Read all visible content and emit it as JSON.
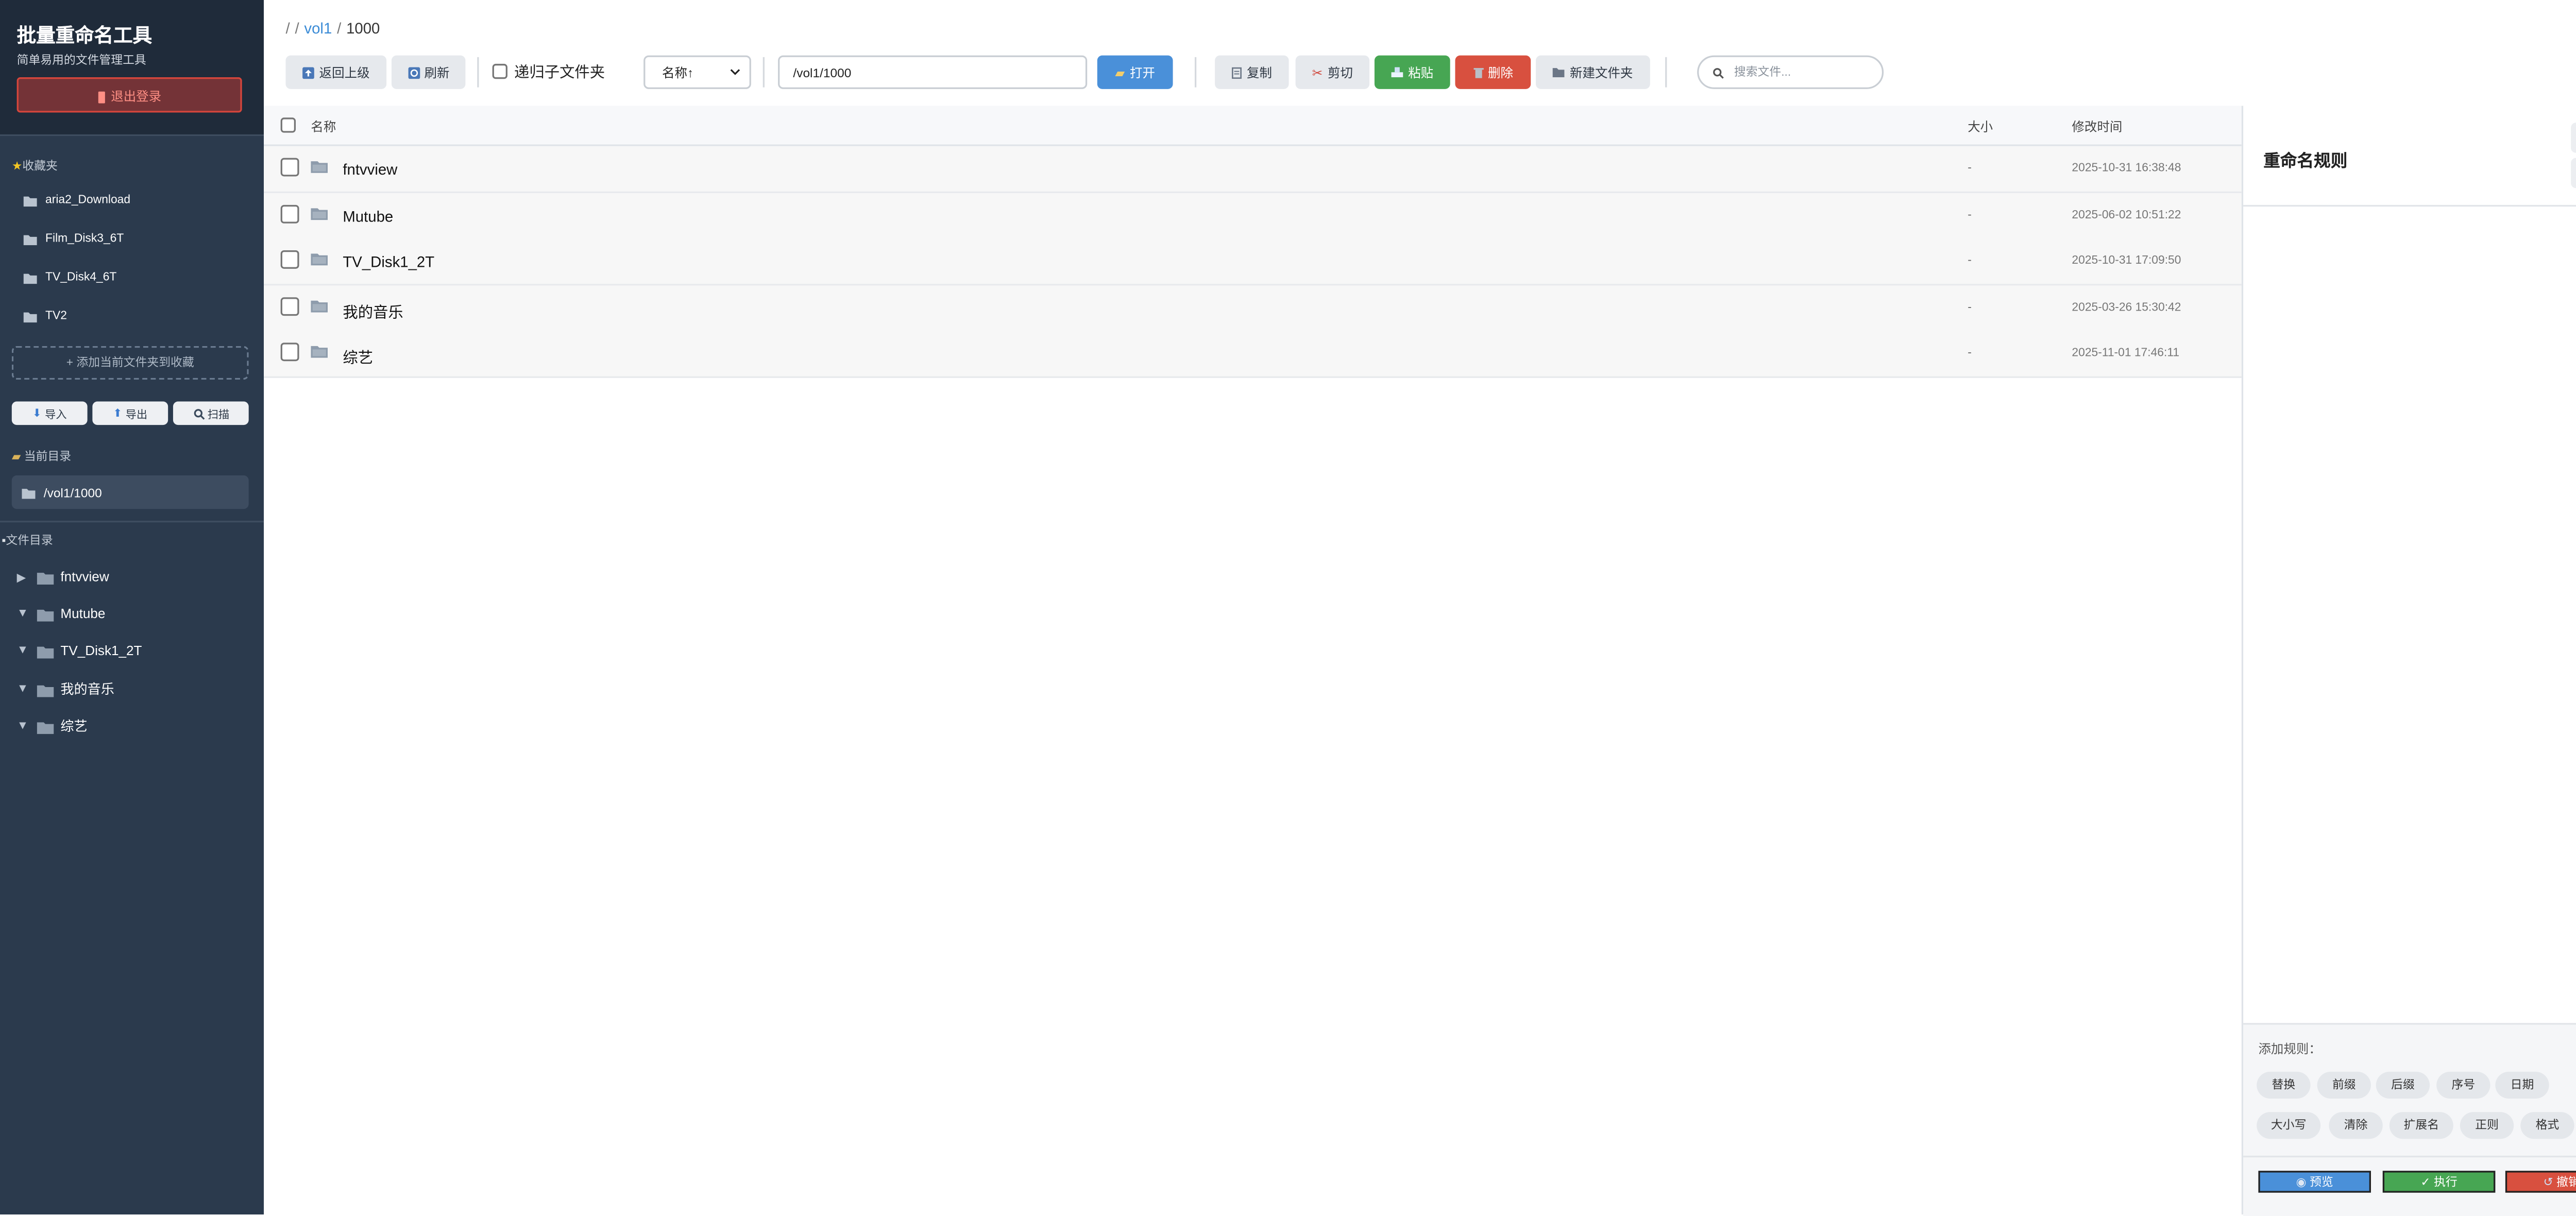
{
  "sidebar": {
    "title": "批量重命名工具",
    "subtitle": "简单易用的文件管理工具",
    "logout": "退出登录",
    "favorites_title": "收藏夹",
    "favorites": [
      "aria2_Download",
      "Film_Disk3_6T",
      "TV_Disk4_6T",
      "TV2"
    ],
    "add_favorite": "+ 添加当前文件夹到收藏",
    "import": "导入",
    "export": "导出",
    "scan": "扫描",
    "current_dir_title": "当前目录",
    "current_dir": "/vol1/1000",
    "tree_title": "文件目录",
    "tree": [
      {
        "name": "fntvview",
        "expanded": false
      },
      {
        "name": "Mutube",
        "expanded": true
      },
      {
        "name": "TV_Disk1_2T",
        "expanded": true
      },
      {
        "name": "我的音乐",
        "expanded": true
      },
      {
        "name": "综艺",
        "expanded": true
      }
    ]
  },
  "toolbar": {
    "breadcrumb": {
      "root": "/",
      "sep": "/",
      "vol": "vol1",
      "current": "1000"
    },
    "back": "返回上级",
    "refresh": "刷新",
    "recursive": "递归子文件夹",
    "sort": "名称↑",
    "path": "/vol1/1000",
    "open": "打开",
    "copy": "复制",
    "cut": "剪切",
    "paste": "粘贴",
    "delete": "删除",
    "new_folder": "新建文件夹",
    "search_placeholder": "搜索文件..."
  },
  "table": {
    "headers": {
      "name": "名称",
      "size": "大小",
      "modified": "修改时间"
    },
    "rows": [
      {
        "name": "fntvview",
        "size": "-",
        "modified": "2025-10-31 16:38:48"
      },
      {
        "name": "Mutube",
        "size": "-",
        "modified": "2025-06-02 10:51:22"
      },
      {
        "name": "TV_Disk1_2T",
        "size": "-",
        "modified": "2025-10-31 17:09:50"
      },
      {
        "name": "我的音乐",
        "size": "-",
        "modified": "2025-03-26 15:30:42"
      },
      {
        "name": "综艺",
        "size": "-",
        "modified": "2025-11-01 17:46:11"
      }
    ]
  },
  "rules": {
    "title": "重命名规则",
    "add_label": "添加规则：",
    "chips_row1": [
      "替换",
      "前缀",
      "后缀",
      "序号",
      "日期"
    ],
    "chips_row2": [
      "大小写",
      "清除",
      "扩展名",
      "正则",
      "格式"
    ],
    "preview": "预览",
    "execute": "执行",
    "undo": "撤销"
  },
  "colors": {
    "sidebar_bg": "#2b3a4d",
    "accent_blue": "#4a90d9",
    "success_green": "#47a653",
    "danger_red": "#d8503f"
  },
  "icons": [
    "folder-icon",
    "star-icon",
    "search-icon",
    "gear-icon",
    "trash-icon",
    "back-icon",
    "refresh-icon",
    "copy-icon",
    "cut-icon",
    "paste-icon",
    "check-icon",
    "undo-icon",
    "eye-icon",
    "logout-icon",
    "chevron-down-icon",
    "triangle-right-icon",
    "triangle-down-icon"
  ]
}
